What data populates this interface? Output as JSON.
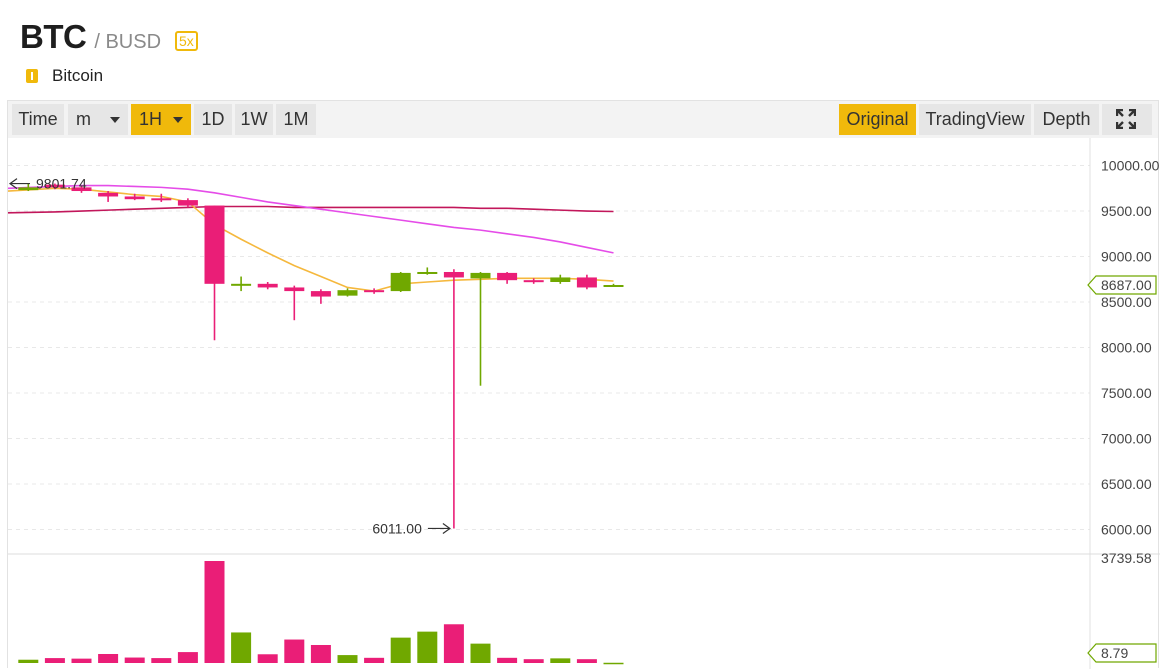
{
  "header": {
    "base": "BTC",
    "quote": "/ BUSD",
    "leverage": "5x",
    "name": "Bitcoin",
    "name_icon": "info-icon",
    "accent": "#f0b90b"
  },
  "toolbar": {
    "time": "Time",
    "minute": "m",
    "h1": "1H",
    "d1": "1D",
    "w1": "1W",
    "mo1": "1M",
    "original": "Original",
    "tradingview": "TradingView",
    "depth": "Depth",
    "fullscreen_icon": "fullscreen-icon"
  },
  "chart_data": {
    "type": "candlestick",
    "y_ticks": [
      "10000.00",
      "9500.00",
      "9000.00",
      "8500.00",
      "8000.00",
      "7500.00",
      "7000.00",
      "6500.00",
      "6000.00"
    ],
    "ylim": [
      5950,
      10050
    ],
    "current_price": "8687.00",
    "high_annotation": "9801.74",
    "low_annotation": "6011.00",
    "volume_max_label": "3739.58",
    "volume_current_label": "8.79",
    "colors": {
      "up": "#70a800",
      "down": "#ea1e77",
      "ma_short": "#f5b83d",
      "ma_mid": "#e54ce8",
      "ma_long": "#c2175b"
    },
    "candles": [
      {
        "o": 9730,
        "c": 9760,
        "h": 9800,
        "l": 9720
      },
      {
        "o": 9790,
        "c": 9760,
        "h": 9802,
        "l": 9740
      },
      {
        "o": 9760,
        "c": 9720,
        "h": 9780,
        "l": 9700
      },
      {
        "o": 9700,
        "c": 9660,
        "h": 9720,
        "l": 9600
      },
      {
        "o": 9660,
        "c": 9630,
        "h": 9690,
        "l": 9620
      },
      {
        "o": 9640,
        "c": 9620,
        "h": 9690,
        "l": 9600
      },
      {
        "o": 9620,
        "c": 9560,
        "h": 9640,
        "l": 9540
      },
      {
        "o": 9560,
        "c": 8700,
        "h": 9560,
        "l": 8080
      },
      {
        "o": 8690,
        "c": 8700,
        "h": 8780,
        "l": 8620
      },
      {
        "o": 8700,
        "c": 8660,
        "h": 8720,
        "l": 8640
      },
      {
        "o": 8660,
        "c": 8620,
        "h": 8680,
        "l": 8300
      },
      {
        "o": 8620,
        "c": 8560,
        "h": 8640,
        "l": 8480
      },
      {
        "o": 8570,
        "c": 8630,
        "h": 8650,
        "l": 8560
      },
      {
        "o": 8630,
        "c": 8610,
        "h": 8650,
        "l": 8590
      },
      {
        "o": 8620,
        "c": 8820,
        "h": 8830,
        "l": 8610
      },
      {
        "o": 8820,
        "c": 8830,
        "h": 8880,
        "l": 8800
      },
      {
        "o": 8830,
        "c": 8770,
        "h": 8860,
        "l": 6011
      },
      {
        "o": 8760,
        "c": 8820,
        "h": 8830,
        "l": 7580
      },
      {
        "o": 8820,
        "c": 8740,
        "h": 8830,
        "l": 8700
      },
      {
        "o": 8740,
        "c": 8720,
        "h": 8760,
        "l": 8700
      },
      {
        "o": 8720,
        "c": 8770,
        "h": 8800,
        "l": 8700
      },
      {
        "o": 8770,
        "c": 8660,
        "h": 8800,
        "l": 8640
      },
      {
        "o": 8680,
        "c": 8687,
        "h": 8700,
        "l": 8670
      }
    ],
    "volumes": [
      120,
      180,
      160,
      330,
      200,
      180,
      400,
      3739.58,
      1120,
      320,
      860,
      660,
      290,
      190,
      930,
      1150,
      1420,
      710,
      190,
      140,
      170,
      140,
      8.79
    ],
    "ma_short": [
      9720,
      9750,
      9740,
      9710,
      9680,
      9660,
      9600,
      9350,
      9190,
      9040,
      8900,
      8780,
      8660,
      8620,
      8700,
      8720,
      8740,
      8750,
      8760,
      8760,
      8760,
      8750,
      8730
    ],
    "ma_mid": [
      9750,
      9770,
      9780,
      9780,
      9770,
      9760,
      9740,
      9700,
      9650,
      9600,
      9560,
      9520,
      9480,
      9440,
      9400,
      9360,
      9320,
      9290,
      9250,
      9210,
      9160,
      9100,
      9040
    ],
    "ma_long": [
      9480,
      9490,
      9500,
      9510,
      9520,
      9530,
      9540,
      9550,
      9550,
      9550,
      9540,
      9540,
      9540,
      9540,
      9540,
      9540,
      9540,
      9530,
      9530,
      9520,
      9510,
      9500,
      9495
    ]
  }
}
